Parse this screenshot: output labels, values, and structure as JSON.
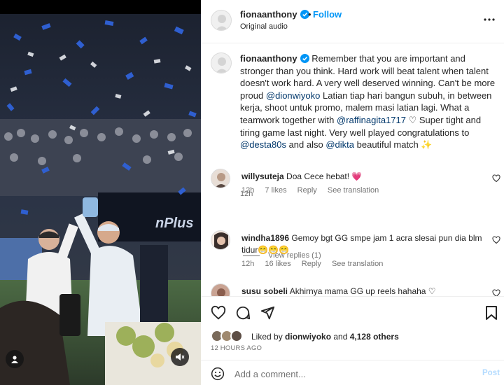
{
  "post_author": {
    "username": "fionaanthony",
    "follow_label": "Follow",
    "separator": "•",
    "audio_label": "Original audio"
  },
  "caption": {
    "username": "fionaanthony",
    "text_1": " Remember that you are important and stronger than you think. Hard work will beat talent when talent doesn't work hard. A very well deserved winning. Can't be more proud ",
    "mention_1": "@dionwiyoko",
    "text_2": " Latian tiap hari bangun subuh, in between kerja, shoot untuk promo, malem masi latian lagi. What a teamwork together with ",
    "mention_2": "@raffinagita1717",
    "text_3": " ♡ Super tight and tiring game last night. Very well played congratulations to ",
    "mention_3": "@desta80s",
    "text_4": " and also ",
    "mention_4": "@dikta",
    "text_5": " beautiful match ✨",
    "time": "12h"
  },
  "comments": [
    {
      "username": "willysuteja",
      "text": " Doa Cece hebat! 💗",
      "time": "12h",
      "likes": "7 likes",
      "reply_label": "Reply",
      "translate_label": "See translation",
      "view_replies": "View replies (1)"
    },
    {
      "username": "windha1896",
      "text": " Gemoy bgt GG smpe jam 1 acra slesai pun dia blm tidur😁😁😁",
      "time": "12h",
      "likes": "16 likes",
      "reply_label": "Reply",
      "translate_label": "See translation"
    },
    {
      "username": "susu sobeli",
      "text": " Akhirnya mama GG up reels hahaha ♡"
    }
  ],
  "likes": {
    "prefix": "Liked by ",
    "user": "dionwiyoko",
    "middle": " and ",
    "count": "4,128 others"
  },
  "timestamp": "12 HOURS AGO",
  "composer": {
    "placeholder": "Add a comment...",
    "post_label": "Post"
  },
  "icons": {
    "more": "more-horizontal-icon",
    "like": "heart-icon",
    "comment": "comment-icon",
    "share": "send-icon",
    "save": "bookmark-icon",
    "emoji": "emoji-icon",
    "mute": "speaker-muted-icon",
    "tagged": "person-icon"
  },
  "colors": {
    "accent": "#0095f6",
    "mention": "#00376b",
    "muted": "#737373",
    "verified": "#0095f6",
    "post_disabled": "#b3dbff"
  }
}
